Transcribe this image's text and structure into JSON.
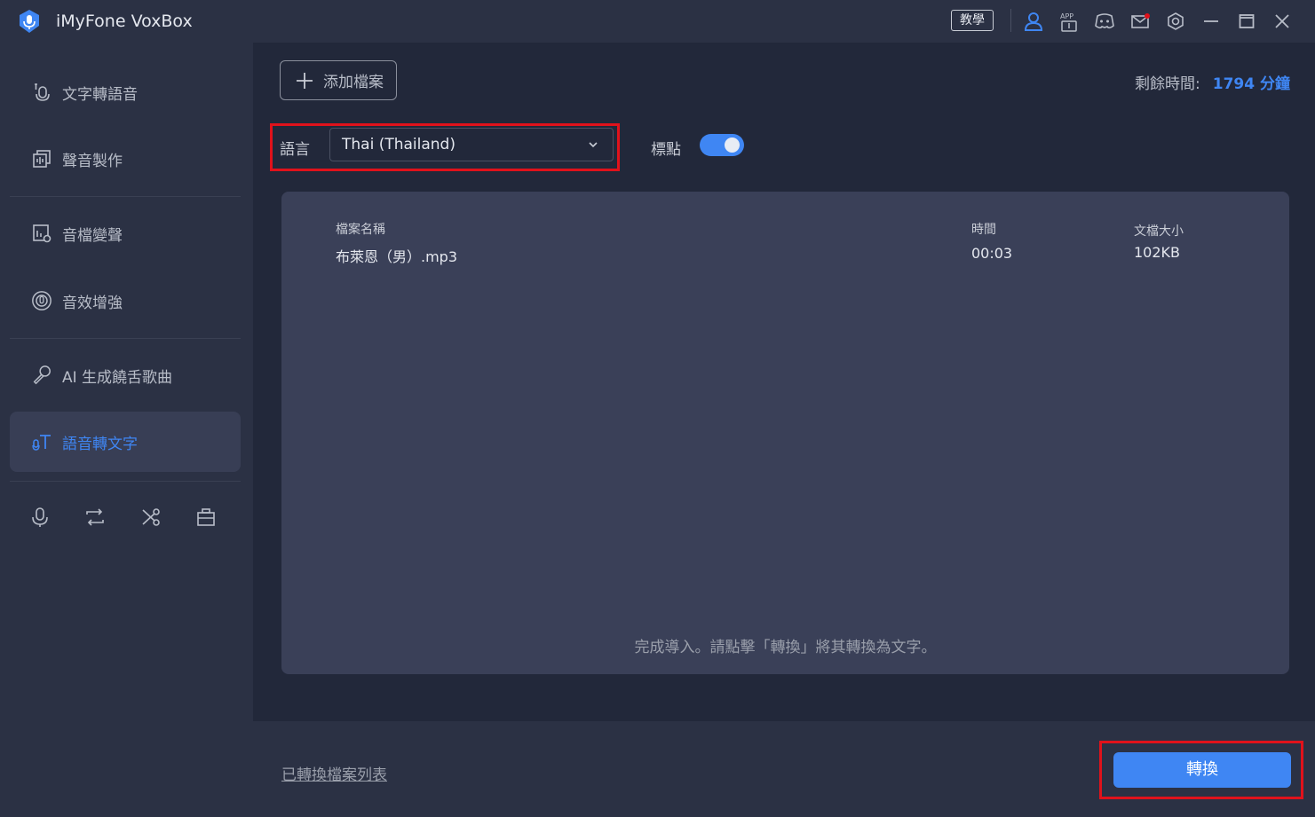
{
  "app": {
    "title": "iMyFone VoxBox",
    "tutorial_label": "教學"
  },
  "sidebar": {
    "items": [
      {
        "label": "文字轉語音",
        "icon": "text-to-speech-icon"
      },
      {
        "label": "聲音製作",
        "icon": "voice-clone-icon"
      },
      {
        "label": "音檔變聲",
        "icon": "voice-changer-icon"
      },
      {
        "label": "音效增強",
        "icon": "audio-enhance-icon"
      },
      {
        "label": "AI 生成饒舌歌曲",
        "icon": "microphone-icon"
      },
      {
        "label": "語音轉文字",
        "icon": "speech-to-text-icon",
        "active": true
      }
    ],
    "tools": [
      "record-icon",
      "convert-icon",
      "cut-icon",
      "toolbox-icon"
    ]
  },
  "main": {
    "add_file_label": "添加檔案",
    "remaining_label": "剩餘時間:",
    "remaining_value": "1794 分鐘",
    "language_label": "語言",
    "language_value": "Thai (Thailand)",
    "punctuation_label": "標點",
    "punctuation_on": true,
    "table": {
      "headers": {
        "name": "檔案名稱",
        "duration": "時間",
        "size": "文檔大小"
      },
      "rows": [
        {
          "name": "布萊恩（男）.mp3",
          "duration": "00:03",
          "size": "102KB"
        }
      ]
    },
    "hint": "完成導入。請點擊「轉換」將其轉換為文字。"
  },
  "footer": {
    "converted_list_label": "已轉換檔案列表",
    "convert_label": "轉換"
  },
  "colors": {
    "accent": "#3f86f3",
    "highlight": "#e0121b",
    "background": "#22283a",
    "panel": "#3a4058"
  }
}
